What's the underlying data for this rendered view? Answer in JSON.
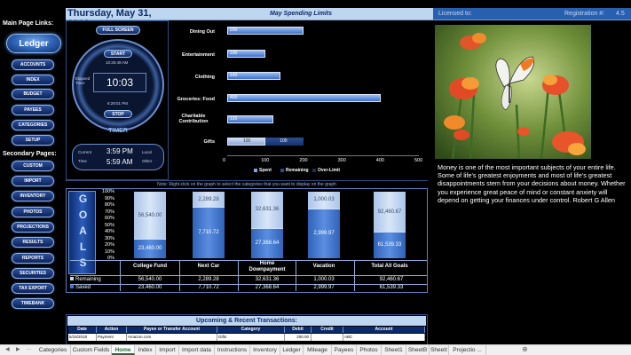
{
  "nav": {
    "main_heading": "Main Page Links:",
    "ledger": "Ledger",
    "main_links": [
      "ACCOUNTS",
      "INDEX",
      "BUDGET",
      "PAYEES",
      "CATEGORIES",
      "SETUP"
    ],
    "secondary_heading": "Secondary Pages:",
    "secondary_links": [
      "CUSTOM",
      "IMPORT",
      "INVENTORY",
      "PHOTOS",
      "PROJECTIONS",
      "RESULTS",
      "REPORTS",
      "SECURITIES",
      "TAX EXPORT",
      "TIMEBANK"
    ]
  },
  "timer": {
    "date": "Thursday, May 31, 2018",
    "full_screen": "FULL SCREEN",
    "start": "START",
    "start_time": "10:25:49 AM",
    "elapsed_label": "Elapsed Time:",
    "elapsed": "10:03",
    "stop_time": "6:29:01 PM",
    "stop": "STOP",
    "label": "TIMER",
    "current_label": "Current",
    "time_label": "Time",
    "current_time": "3:59 PM",
    "other_time": "5:59 AM",
    "local_label": "Local",
    "other_label": "Other"
  },
  "spending": {
    "title": "May  Spending Limits",
    "categories": [
      "Dining Out",
      "Entertainment",
      "Clothing",
      "Groceries: Food",
      "Charitable Contribution",
      "Gifts"
    ],
    "legend": [
      "Spent",
      "Remaining",
      "Over-Limit"
    ]
  },
  "chart_data": [
    {
      "type": "bar",
      "title": "May  Spending Limits",
      "orientation": "horizontal",
      "categories": [
        "Dining Out",
        "Entertainment",
        "Clothing",
        "Groceries: Food",
        "Charitable Contribution",
        "Gifts"
      ],
      "series": [
        {
          "name": "Spent",
          "values": [
            200,
            100,
            140,
            400,
            120,
            0
          ]
        },
        {
          "name": "Remaining",
          "values": [
            0,
            0,
            0,
            0,
            0,
            100
          ]
        },
        {
          "name": "Over-Limit",
          "values": [
            0,
            0,
            0,
            0,
            0,
            0
          ]
        }
      ],
      "extra_labels": [
        "200",
        "100",
        "140",
        "400",
        "120",
        "100",
        "100"
      ],
      "xlim": [
        0,
        500
      ],
      "xticks": [
        "0",
        "100",
        "200",
        "300",
        "400",
        "500"
      ],
      "legend": "bottom"
    },
    {
      "type": "bar",
      "stacked": true,
      "categories": [
        "College Fund",
        "Next Car",
        "Home Downpayment",
        "Vacation",
        "Total All Goals"
      ],
      "series": [
        {
          "name": "Remaining",
          "values": [
            56540.0,
            2289.28,
            32631.36,
            1000.03,
            92460.67
          ]
        },
        {
          "name": "Saved",
          "values": [
            23460.0,
            7710.72,
            27368.64,
            2999.97,
            61539.33
          ]
        }
      ],
      "saved_fraction": [
        0.2933,
        0.7711,
        0.4562,
        0.75,
        0.3996
      ],
      "yticks": [
        "0%",
        "10%",
        "20%",
        "30%",
        "40%",
        "50%",
        "60%",
        "70%",
        "80%",
        "90%",
        "100%"
      ]
    }
  ],
  "goals": {
    "letters": [
      "G",
      "O",
      "A",
      "L",
      "S"
    ],
    "note": "Note:  Right-click on the graph to select the categories that you want to display on the graph",
    "pct": [
      "100%",
      "90%",
      "80%",
      "70%",
      "60%",
      "50%",
      "40%",
      "30%",
      "20%",
      "10%",
      "0%"
    ],
    "headers": [
      "College Fund",
      "Next Car",
      "Home Downpayment",
      "Vacation",
      "Total All Goals"
    ],
    "remaining_label": "Remaining",
    "saved_label": "Saved",
    "remaining": [
      "56,540.00",
      "2,289.28",
      "32,631.36",
      "1,000.03",
      "92,460.67"
    ],
    "saved": [
      "23,460.00",
      "7,710.72",
      "27,368.64",
      "2,999.97",
      "61,539.33"
    ]
  },
  "license": {
    "licensed_to": "Licensed to:",
    "registration": "Registration #:",
    "reg_value": "4.5"
  },
  "quote": "Money is one of the most important subjects of your entire life. Some of life's greatest enjoyments and most of life's greatest disappointments stem from your decisions about money. Whether you experience great peace of mind or constant anxiety will depend on getting your finances under control. Robert G Allen",
  "transactions": {
    "title": "Upcoming & Recent Transactions:",
    "columns": [
      "Date",
      "Action",
      "Payee or Transfer Account",
      "Category",
      "Debit",
      "Credit",
      "Account"
    ],
    "rows": [
      [
        "5/15/2018",
        "Payment",
        "Amazon.com",
        "Gifts",
        "200.00",
        "",
        "ABC"
      ]
    ]
  },
  "tabs": {
    "items": [
      "Categories",
      "Custom Fields",
      "Home",
      "Index",
      "Import",
      "Import data",
      "Instructions",
      "Inventory",
      "Ledger",
      "Mileage",
      "Payees",
      "Photos",
      "Sheet1",
      "SheetB",
      "SheetI",
      "Projectio ..."
    ],
    "active": "Home",
    "nav": [
      "◀",
      "▶",
      "..."
    ]
  }
}
